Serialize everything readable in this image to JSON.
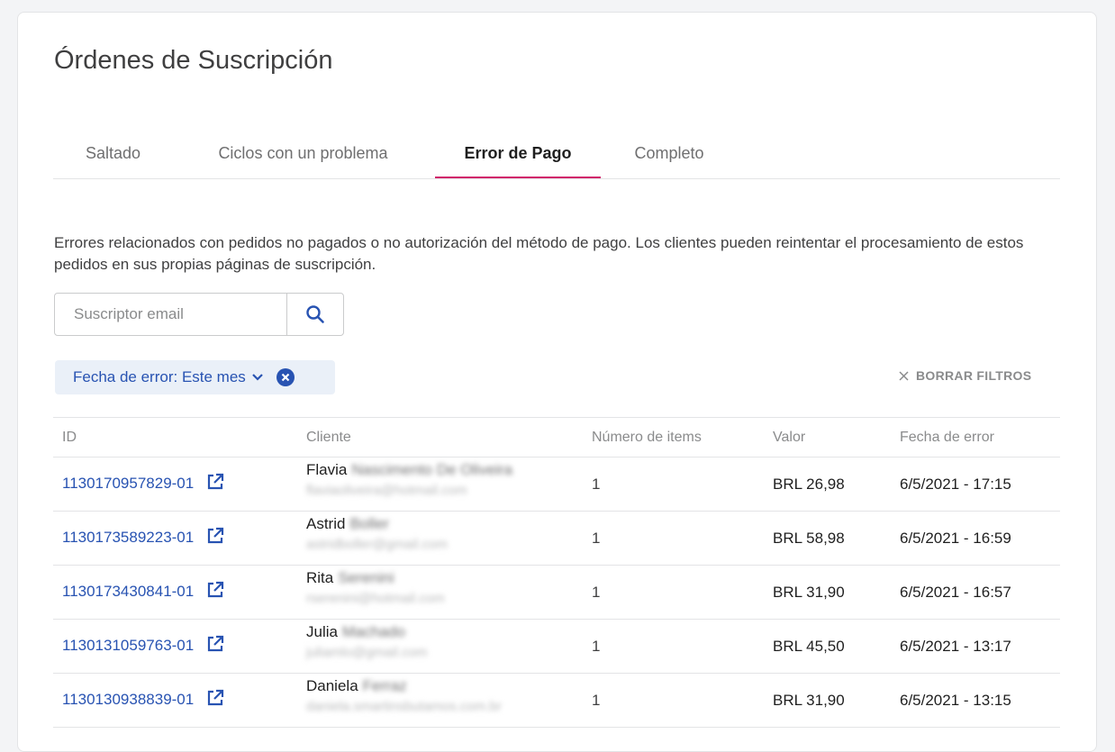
{
  "page": {
    "title": "Órdenes de Suscripción"
  },
  "tabs": [
    {
      "label": "Saltado",
      "active": false
    },
    {
      "label": "Ciclos con un problema",
      "active": false
    },
    {
      "label": "Error de Pago",
      "active": true
    },
    {
      "label": "Completo",
      "active": false
    }
  ],
  "description": "Errores relacionados con pedidos no pagados o no autorización del método de pago. Los clientes pueden reintentar el procesamiento de estos pedidos en sus propias páginas de suscripción.",
  "search": {
    "placeholder": "Suscriptor email",
    "value": "",
    "icon": "search-icon"
  },
  "filter_chip": {
    "label": "Fecha de error: Este mes",
    "icons": [
      "chevron-down-icon",
      "close-circle-icon"
    ]
  },
  "clear_filters": {
    "label": "BORRAR FILTROS",
    "icon": "close-icon"
  },
  "table": {
    "headers": {
      "id": "ID",
      "client": "Cliente",
      "items": "Número de items",
      "value": "Valor",
      "date": "Fecha de error"
    },
    "rows": [
      {
        "id": "1130170957829-01",
        "first_name": "Flavia",
        "last_name": "Nascimento De Oliveira",
        "email": "flaviaoliveira@hotmail.com",
        "items": "1",
        "value": "BRL 26,98",
        "date": "6/5/2021 - 17:15"
      },
      {
        "id": "1130173589223-01",
        "first_name": "Astrid",
        "last_name": "Boller",
        "email": "astridboller@gmail.com",
        "items": "1",
        "value": "BRL 58,98",
        "date": "6/5/2021 - 16:59"
      },
      {
        "id": "1130173430841-01",
        "first_name": "Rita",
        "last_name": "Serenini",
        "email": "rserenini@hotmail.com",
        "items": "1",
        "value": "BRL 31,90",
        "date": "6/5/2021 - 16:57"
      },
      {
        "id": "1130131059763-01",
        "first_name": "Julia",
        "last_name": "Machado",
        "email": "juliamlo@gmail.com",
        "items": "1",
        "value": "BRL 45,50",
        "date": "6/5/2021 - 13:17"
      },
      {
        "id": "1130130938839-01",
        "first_name": "Daniela",
        "last_name": "Ferraz",
        "email": "daniela.smartinsbutamos.com.br",
        "items": "1",
        "value": "BRL 31,90",
        "date": "6/5/2021 - 13:15"
      }
    ]
  },
  "colors": {
    "accent_tab": "#d0216a",
    "link": "#2853b2",
    "chip_bg": "#eaf0f8"
  }
}
